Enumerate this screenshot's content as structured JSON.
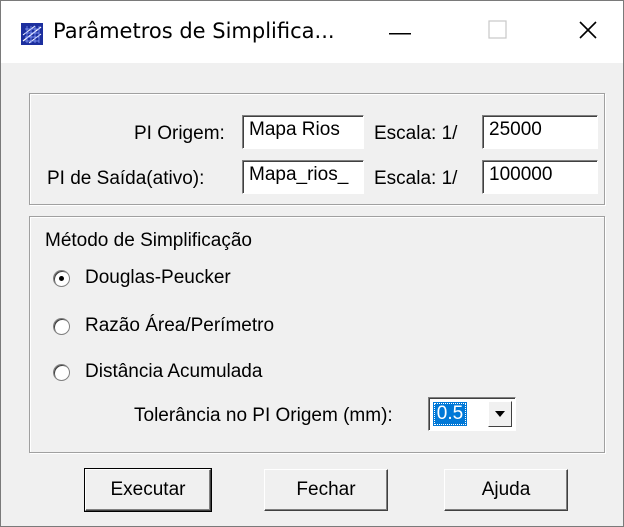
{
  "window": {
    "title": "Parâmetros de Simplifica...",
    "icons": [
      "app-icon",
      "minimize-icon",
      "maximize-icon",
      "close-icon"
    ]
  },
  "source": {
    "label": "PI Origem:",
    "value": "Mapa Rios",
    "scale_label": "Escala: 1/",
    "scale_value": "25000"
  },
  "output": {
    "label": "PI de Saída(ativo):",
    "value": "Mapa_rios_",
    "scale_label": "Escala: 1/",
    "scale_value": "100000"
  },
  "method": {
    "group_label": "Método de Simplificação",
    "options": [
      {
        "label": "Douglas-Peucker",
        "selected": true
      },
      {
        "label": "Razão Área/Perímetro",
        "selected": false
      },
      {
        "label": "Distância Acumulada",
        "selected": false
      }
    ],
    "tolerance_label": "Tolerância no PI Origem (mm):",
    "tolerance_value": "0.5"
  },
  "buttons": {
    "execute": "Executar",
    "close": "Fechar",
    "help": "Ajuda"
  }
}
